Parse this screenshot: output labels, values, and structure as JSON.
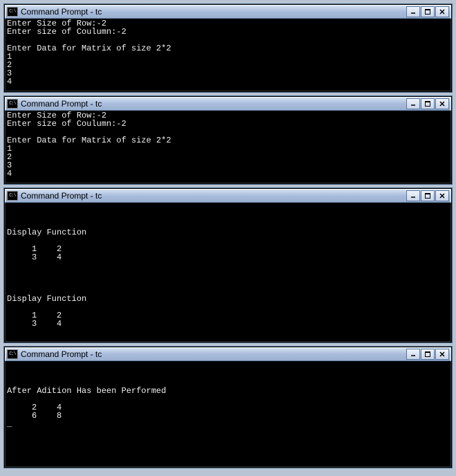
{
  "windows": [
    {
      "title": "Command Prompt - tc",
      "icon_label": "C:\\",
      "content": "Enter Size of Row:-2\nEnter size of Coulumn:-2\n\nEnter Data for Matrix of size 2*2\n1\n2\n3\n4"
    },
    {
      "title": "Command Prompt - tc",
      "icon_label": "C:\\",
      "content": "Enter Size of Row:-2\nEnter size of Coulumn:-2\n\nEnter Data for Matrix of size 2*2\n1\n2\n3\n4"
    },
    {
      "title": "Command Prompt - tc",
      "icon_label": "C:\\",
      "content": "\n\n\nDisplay Function\n\n     1    2\n     3    4\n\n\n\n\nDisplay Function\n\n     1    2\n     3    4"
    },
    {
      "title": "Command Prompt - tc",
      "icon_label": "C:\\",
      "content": "\n\n\nAfter Adition Has been Performed\n\n     2    4\n     6    8\n_"
    }
  ],
  "controls": {
    "minimize": "_",
    "maximize": "□",
    "close": "×"
  }
}
